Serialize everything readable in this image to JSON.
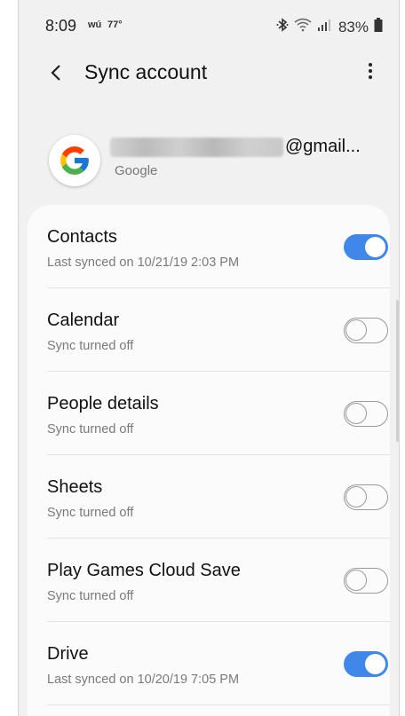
{
  "status_bar": {
    "time": "8:09",
    "notif_label": "wú",
    "temperature": "77°",
    "battery_percent": "83%",
    "icons": [
      "bluetooth-icon",
      "wifi-icon",
      "signal-icon",
      "battery-icon"
    ]
  },
  "app_bar": {
    "title": "Sync account",
    "back_icon": "chevron-left-icon",
    "menu_icon": "more-vertical-icon"
  },
  "account": {
    "email_suffix": "@gmail...",
    "provider": "Google",
    "logo_icon": "google-logo-icon"
  },
  "sync_items": [
    {
      "name": "Contacts",
      "status": "Last synced on 10/21/19  2:03 PM",
      "enabled": true
    },
    {
      "name": "Calendar",
      "status": "Sync turned off",
      "enabled": false
    },
    {
      "name": "People details",
      "status": "Sync turned off",
      "enabled": false
    },
    {
      "name": "Sheets",
      "status": "Sync turned off",
      "enabled": false
    },
    {
      "name": "Play Games Cloud Save",
      "status": "Sync turned off",
      "enabled": false
    },
    {
      "name": "Drive",
      "status": "Last synced on 10/20/19  7:05 PM",
      "enabled": true
    }
  ],
  "colors": {
    "accent": "#3f87e8",
    "background": "#f1f1f1",
    "card": "#fbfbfb"
  }
}
